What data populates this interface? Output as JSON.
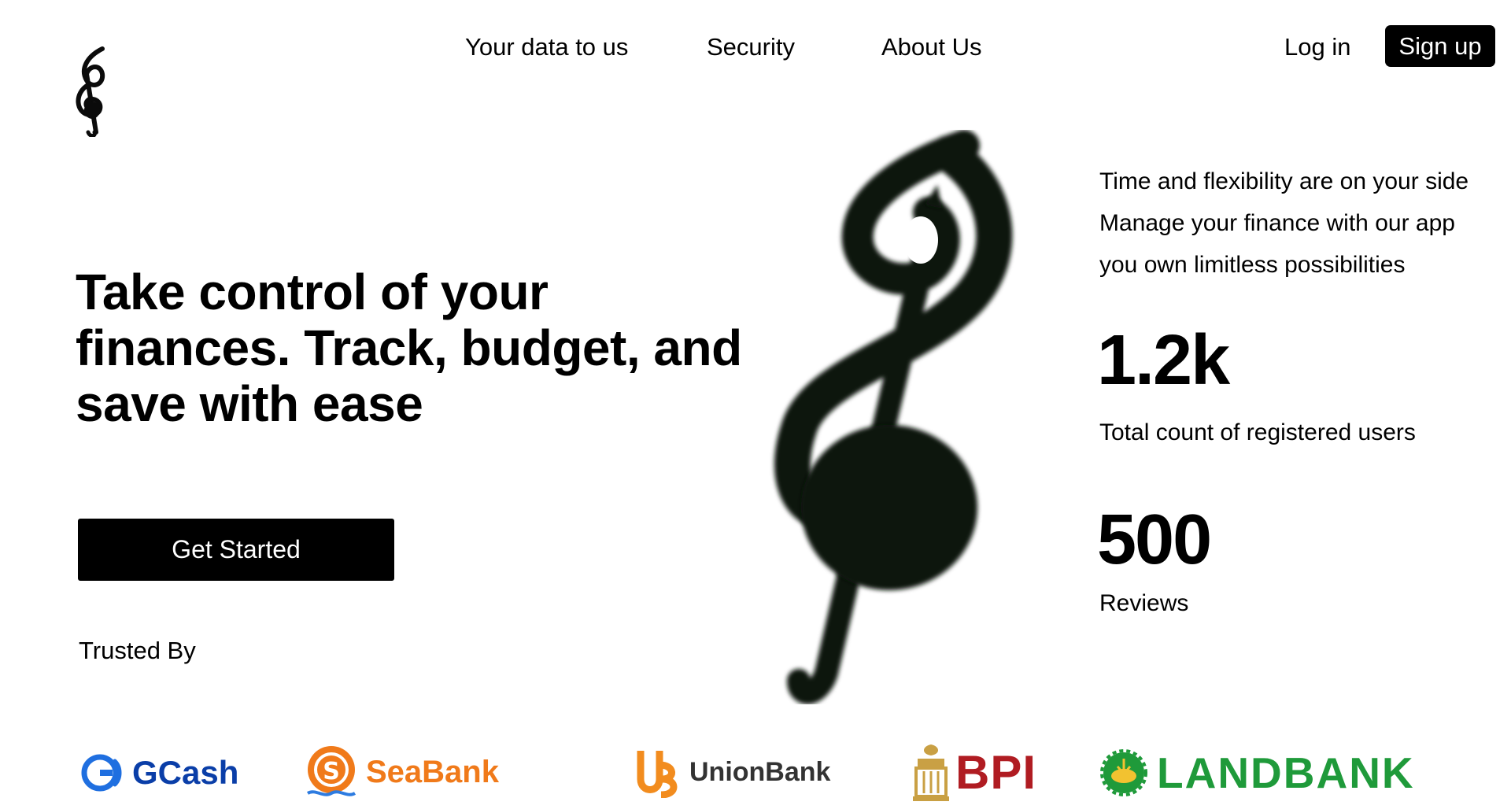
{
  "header": {
    "logo_icon": "treble-clef-leaf-logo",
    "nav": [
      "Your data to us",
      "Security",
      "About Us"
    ],
    "login_label": "Log in",
    "signup_label": "Sign up"
  },
  "hero": {
    "title_lines": [
      "Take control of your",
      "finances. Track, budget, and",
      "save with ease"
    ],
    "cta_label": "Get Started",
    "trusted_label": "Trusted By",
    "image_icon": "treble-clef-leaf-icon"
  },
  "tagline": [
    "Time and flexibility are on your side",
    "Manage your finance with our app",
    "you own limitless possibilities"
  ],
  "stats": {
    "users_value": "1.2k",
    "users_label": "Total count of registered users",
    "reviews_value": "500",
    "reviews_label": "Reviews"
  },
  "partners": [
    {
      "name": "GCash",
      "icon": "gcash-logo-icon",
      "color": "#0a3ea8"
    },
    {
      "name": "SeaBank",
      "icon": "seabank-logo-icon",
      "color": "#f07a1a"
    },
    {
      "name": "UnionBank",
      "icon": "unionbank-logo-icon",
      "color": "#f28c1e"
    },
    {
      "name": "BPI",
      "icon": "bpi-crest-icon",
      "color": "#b01c22"
    },
    {
      "name": "LANDBANK",
      "icon": "landbank-logo-icon",
      "color": "#1f9a3a"
    }
  ]
}
